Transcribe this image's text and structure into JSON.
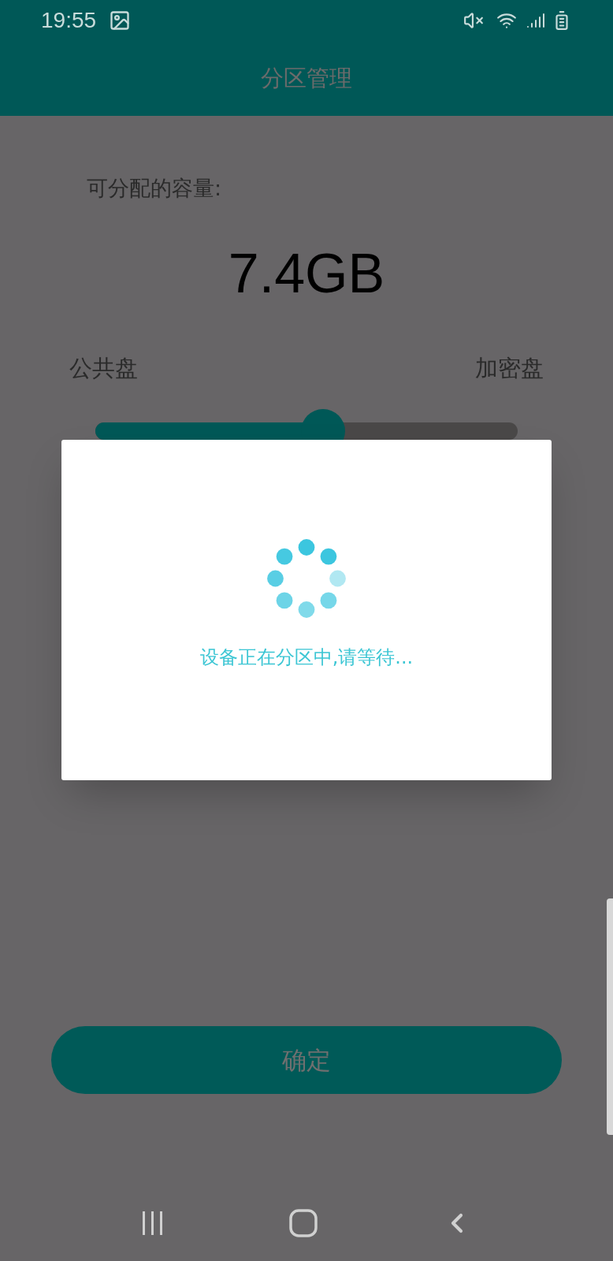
{
  "status_bar": {
    "time": "19:55"
  },
  "app_bar": {
    "title": "分区管理"
  },
  "capacity": {
    "label": "可分配的容量:",
    "value": "7.4GB"
  },
  "partition": {
    "left_label": "公共盘",
    "right_label": "加密盘",
    "level": 0.54
  },
  "dialog": {
    "message": "设备正在分区中,请等待..."
  },
  "confirm_button": {
    "label": "确定",
    "disabled": true
  }
}
